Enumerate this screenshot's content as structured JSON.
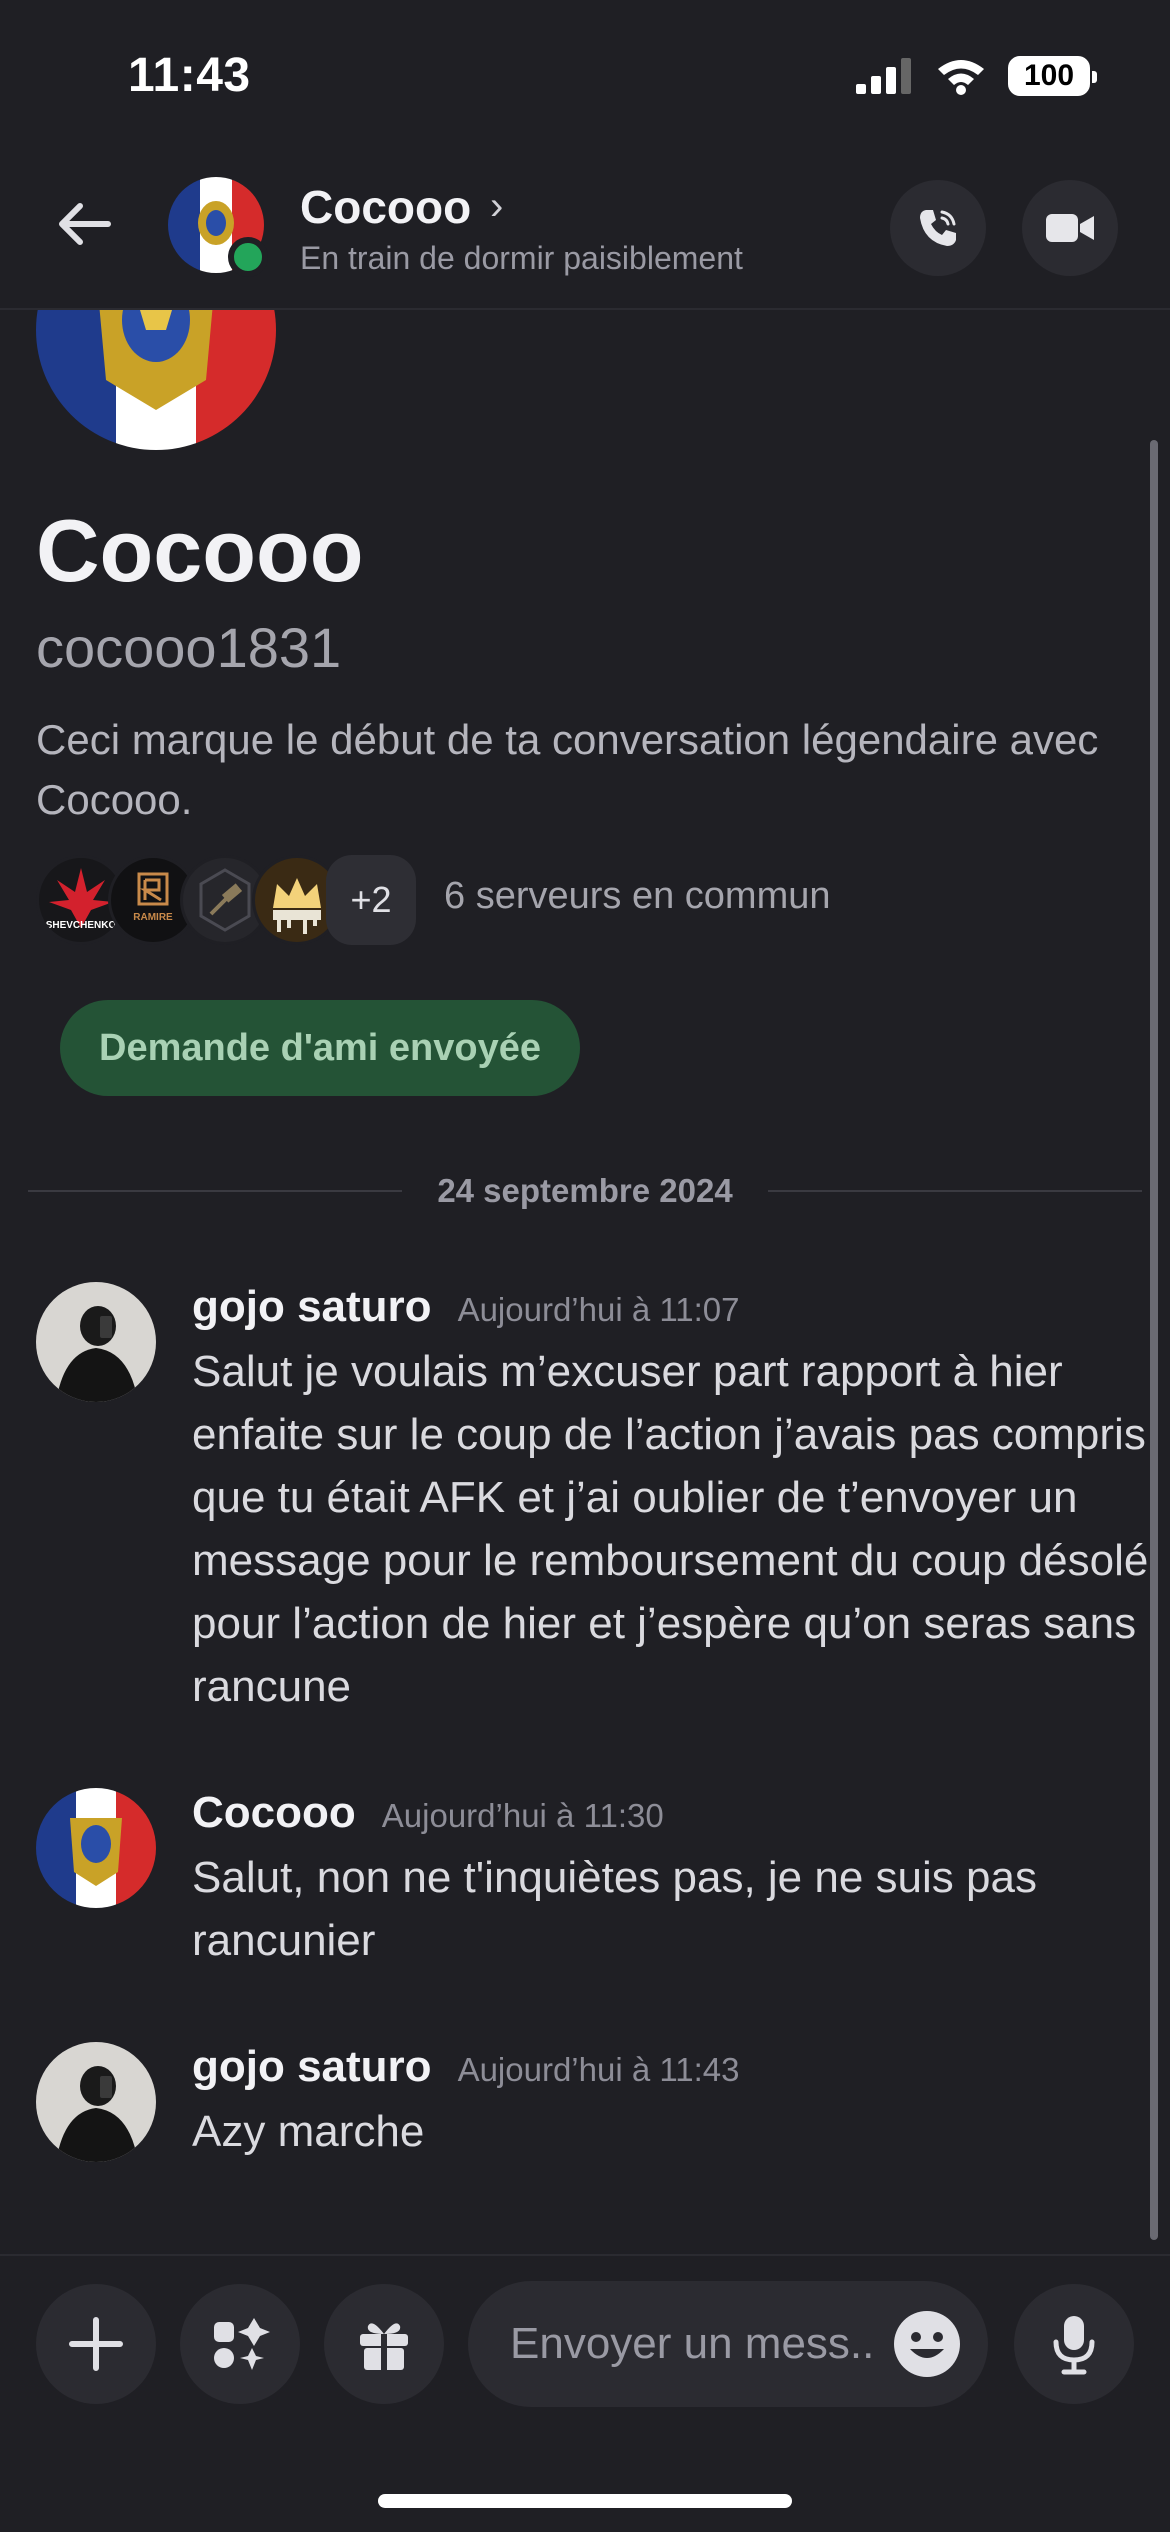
{
  "status_bar": {
    "time": "11:43",
    "battery": "100"
  },
  "header": {
    "name": "Cocooo",
    "status": "En train de dormir paisiblement"
  },
  "profile": {
    "name": "Cocooo",
    "username": "cocooo1831",
    "intro": "Ceci marque le début de ta conversation légendaire avec Cocooo.",
    "servers_more": "+2",
    "servers_common": "6 serveurs en commun",
    "friend_request": "Demande d'ami envoyée",
    "server_badges": [
      "SHEVCHENKO",
      "RAMIRE"
    ]
  },
  "date_divider": "24 septembre 2024",
  "messages": [
    {
      "author": "gojo saturo",
      "time": "Aujourd’hui à 11:07",
      "text": "Salut je voulais m’excuser part rapport à hier enfaite sur le coup de l’action j’avais pas compris que tu était AFK et j’ai oublier de t’envoyer un message pour le remboursement du coup désolé pour l’action de hier et j’espère qu’on seras sans rancune"
    },
    {
      "author": "Cocooo",
      "time": "Aujourd’hui à 11:30",
      "text": "Salut, non ne t'inquiètes pas, je ne suis pas rancunier"
    },
    {
      "author": "gojo saturo",
      "time": "Aujourd’hui à 11:43",
      "text": "Azy marche"
    }
  ],
  "input": {
    "placeholder": "Envoyer un mess.."
  },
  "colors": {
    "background": "#1f1f24",
    "online": "#23a55a",
    "friend_button": "#245336"
  },
  "icons": [
    "back-arrow-icon",
    "chevron-right-icon",
    "phone-icon",
    "video-camera-icon",
    "plus-icon",
    "apps-icon",
    "gift-icon",
    "emoji-icon",
    "microphone-icon"
  ]
}
